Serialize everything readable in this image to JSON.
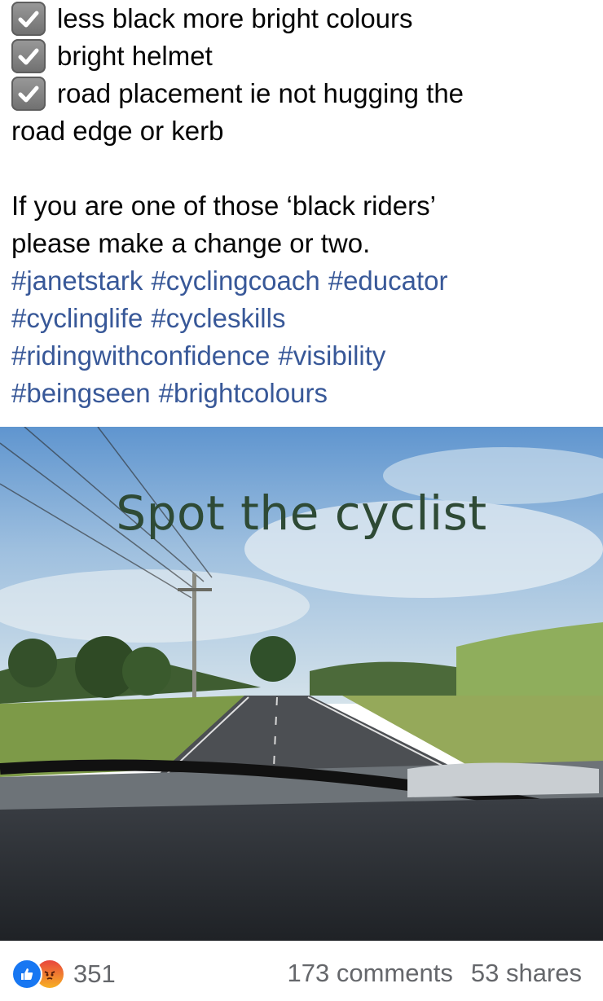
{
  "post": {
    "checklist": [
      {
        "text": "less black more bright colours"
      },
      {
        "text": "bright helmet"
      },
      {
        "text": "road placement ie not hugging the",
        "continuation": "road edge or kerb"
      }
    ],
    "paragraph_lines": [
      "If you are one of those ‘black riders’",
      "please make a change or two."
    ],
    "hashtag_lines": [
      [
        "#janetstark",
        "#cyclingcoach",
        "#educator"
      ],
      [
        "#cyclinglife",
        "#cycleskills"
      ],
      [
        "#ridingwithconfidence",
        "#visibility"
      ],
      [
        "#beingseen",
        "#brightcolours"
      ]
    ],
    "image": {
      "caption": "Spot the cyclist"
    }
  },
  "footer": {
    "reaction_count": "351",
    "comments": "173 comments",
    "shares": "53 shares"
  },
  "colors": {
    "hashtag": "#385898",
    "like_blue": "#1877f2",
    "meta_gray": "#65676b"
  },
  "icons": [
    "checkbox-checked-icon",
    "like-icon",
    "angry-icon"
  ]
}
